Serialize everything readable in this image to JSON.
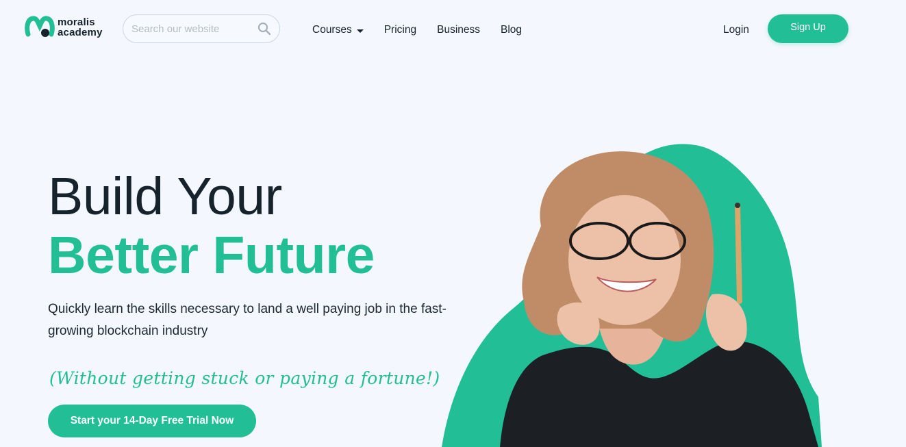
{
  "brand": {
    "logo_line1": "moralis",
    "logo_line2": "academy",
    "accent_color": "#22be96",
    "background_color": "#f4f7fd",
    "text_color": "#16222c"
  },
  "search": {
    "placeholder": "Search our website",
    "icon": "search-icon"
  },
  "nav": {
    "items": [
      {
        "label": "Courses",
        "has_dropdown": true
      },
      {
        "label": "Pricing"
      },
      {
        "label": "Business"
      },
      {
        "label": "Blog"
      }
    ],
    "login_label": "Login",
    "signup_label": "Sign Up"
  },
  "hero": {
    "title_line1": "Build Your",
    "title_line2": "Better Future",
    "description": "Quickly learn the skills necessary to land a well paying job in the fast-growing blockchain industry",
    "note": "(Without getting stuck or paying a fortune!)",
    "cta_label": "Start your 14-Day Free Trial Now",
    "image": "woman-with-glasses-holding-pencil"
  }
}
